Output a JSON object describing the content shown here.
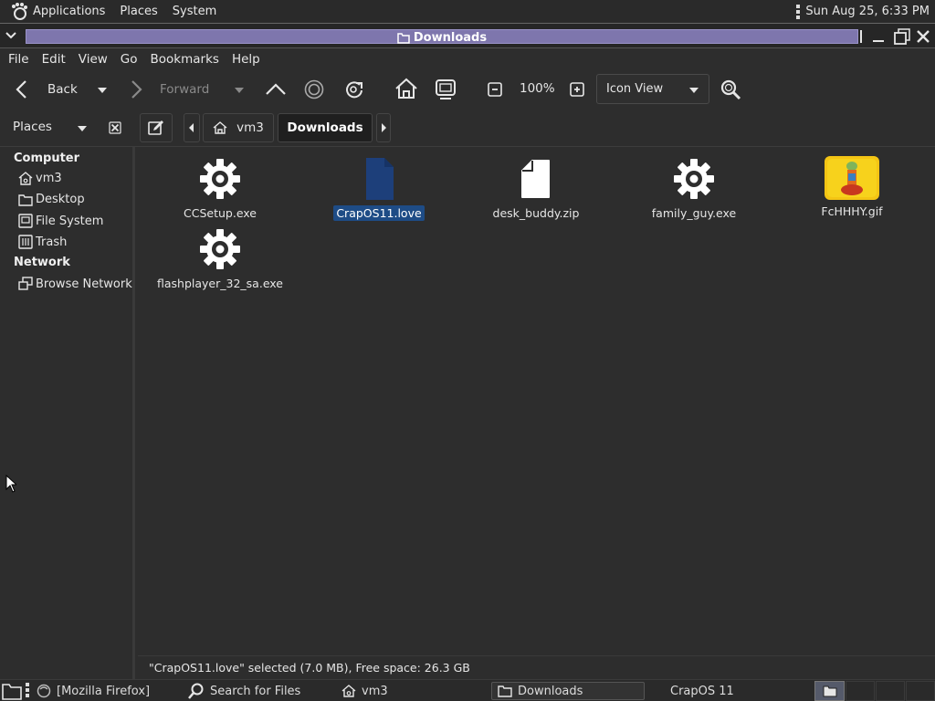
{
  "top_panel": {
    "applications": "Applications",
    "places": "Places",
    "system": "System",
    "clock": "Sun Aug 25,  6:33 PM"
  },
  "window": {
    "title": "Downloads"
  },
  "menubar": {
    "file": "File",
    "edit": "Edit",
    "view": "View",
    "go": "Go",
    "bookmarks": "Bookmarks",
    "help": "Help"
  },
  "toolbar": {
    "back": "Back",
    "forward": "Forward",
    "zoom": "100%",
    "view_mode": "Icon View"
  },
  "locationbar": {
    "sidebar_mode": "Places",
    "crumbs": [
      "vm3",
      "Downloads"
    ]
  },
  "sidebar": {
    "computer_heading": "Computer",
    "network_heading": "Network",
    "items": [
      "vm3",
      "Desktop",
      "File System",
      "Trash"
    ],
    "network_items": [
      "Browse Network"
    ]
  },
  "files": [
    {
      "name": "CCSetup.exe",
      "icon": "gear-icon"
    },
    {
      "name": "CrapOS11.love",
      "icon": "love-file-icon",
      "selected": true
    },
    {
      "name": "desk_buddy.zip",
      "icon": "document-icon"
    },
    {
      "name": "family_guy.exe",
      "icon": "gear-icon"
    },
    {
      "name": "FcHHHY.gif",
      "icon": "image-thumbnail"
    },
    {
      "name": "flashplayer_32_sa.exe",
      "icon": "gear-icon"
    }
  ],
  "status": {
    "text": "\"CrapOS11.love\" selected (7.0 MB), Free space: 26.3 GB"
  },
  "taskbar": {
    "firefox": "[Mozilla Firefox]",
    "search": "Search for Files",
    "vm3": "vm3",
    "downloads": "Downloads",
    "crapos": "CrapOS 11"
  },
  "colors": {
    "title_strip": "#7e76ad",
    "selection": "#1e4c86",
    "background": "#2d2d2d"
  }
}
